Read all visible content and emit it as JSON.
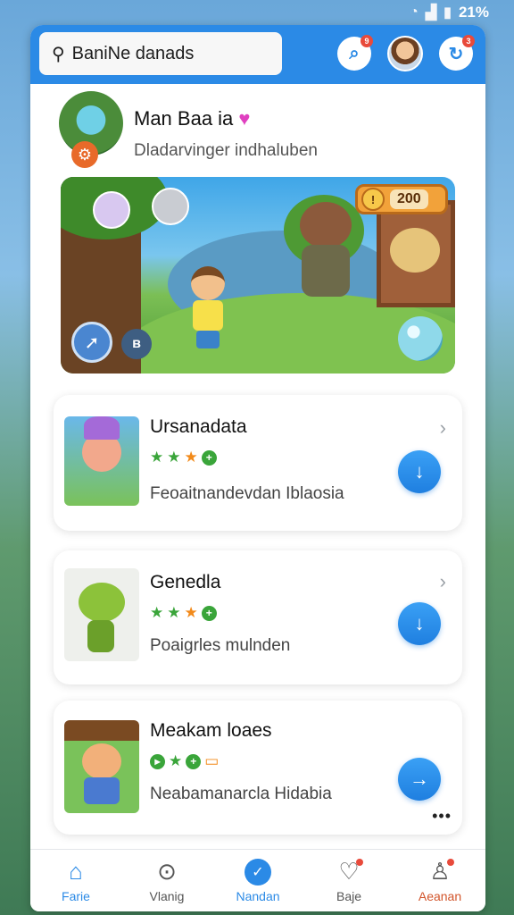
{
  "status_bar": {
    "battery": "21%"
  },
  "header": {
    "search_text": "BaniNe danads",
    "notification_badge": "9",
    "alert_badge": "3"
  },
  "profile": {
    "name": "Man Baa ia",
    "subtitle": "Dladarvinger indhaluben"
  },
  "banner": {
    "coin_value": "200"
  },
  "games": [
    {
      "title": "Ursanadata",
      "description": "Feoaitnandevdan Iblaosia",
      "action": "download"
    },
    {
      "title": "Genedla",
      "description": "Poaigrles mulnden",
      "action": "download"
    },
    {
      "title": "Meakam loaes",
      "description": "Neabamanarcla Hidabia",
      "action": "open"
    }
  ],
  "bottom_nav": [
    {
      "label": "Farie",
      "icon": "home-icon"
    },
    {
      "label": "Vlanig",
      "icon": "search-q-icon"
    },
    {
      "label": "Nandan",
      "icon": "check-circle-icon"
    },
    {
      "label": "Baje",
      "icon": "heart-icon"
    },
    {
      "label": "Aeanan",
      "icon": "user-icon"
    }
  ],
  "colors": {
    "accent": "#2b8ae6",
    "star_green": "#3aa53a",
    "star_orange": "#f28a1a"
  }
}
